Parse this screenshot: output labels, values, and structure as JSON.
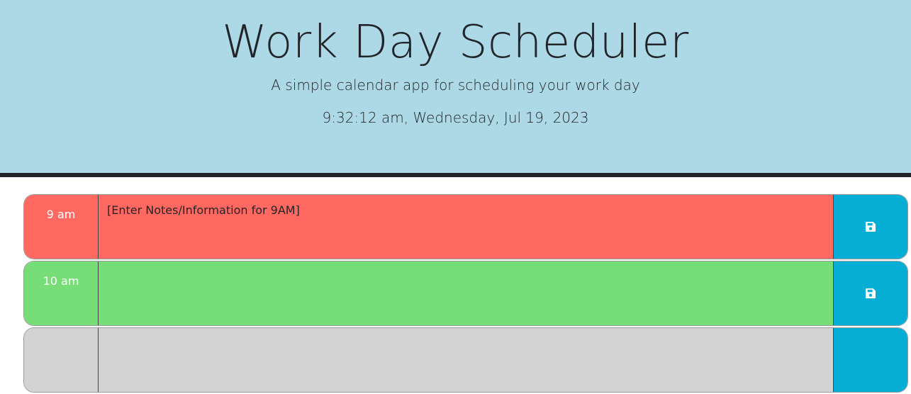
{
  "header": {
    "title": "Work Day Scheduler",
    "lead": "A simple calendar app for scheduling your work day",
    "current_datetime": "9:32:12 am, Wednesday, Jul 19, 2023"
  },
  "colors": {
    "header_bg": "#add8e6",
    "past": "#ff6961",
    "present": "#77dd77",
    "save_button": "#06aed5"
  },
  "time_blocks": [
    {
      "hour_label": "9 am",
      "state": "past",
      "note": "[Enter Notes/Information for 9AM]",
      "save_icon": "floppy-disk-icon"
    },
    {
      "hour_label": "10 am",
      "state": "present",
      "note": "",
      "save_icon": "floppy-disk-icon"
    }
  ]
}
